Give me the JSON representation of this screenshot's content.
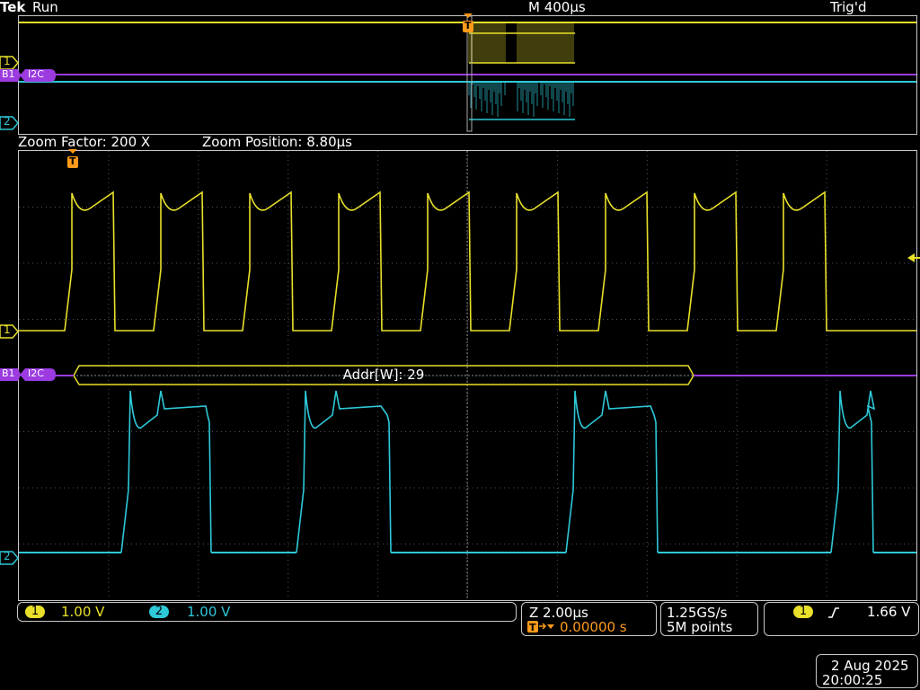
{
  "header": {
    "brand": "Tek",
    "run_state": "Run",
    "horizontal_scale": "M 400µs",
    "trigger_status": "Trig'd"
  },
  "zoom_info": {
    "factor": "Zoom Factor: 200 X",
    "position": "Zoom Position: 8.80µs"
  },
  "markers": {
    "ch1": "1",
    "ch2": "2",
    "bus": "B1",
    "bus_protocol": "I2C",
    "trigger": "T"
  },
  "decode": {
    "label": "Addr[W]: 29"
  },
  "status_bar": {
    "ch1_number": "1",
    "ch1_scale": "1.00 V",
    "ch2_number": "2",
    "ch2_scale": "1.00 V",
    "zoom_timebase": "Z 2.00µs",
    "trigger_position": "0.00000 s",
    "sample_rate": "1.25GS/s",
    "record_length": "5M points",
    "trigger_source": "1",
    "trigger_level": "1.66 V",
    "date": "2 Aug 2025",
    "time": "20:00:25"
  },
  "colors": {
    "ch1": "#e8e02a",
    "ch2": "#2ec8d8",
    "bus": "#9b3be0",
    "trigger": "#ff9a1a",
    "grid": "#555555",
    "frame": "#c8c8c8"
  },
  "icons": {
    "trigger_slope": "rising-edge-icon",
    "trigger_position_arrow": "arrow-right-icon",
    "trigger_level_arrow": "triangle-left-icon"
  }
}
